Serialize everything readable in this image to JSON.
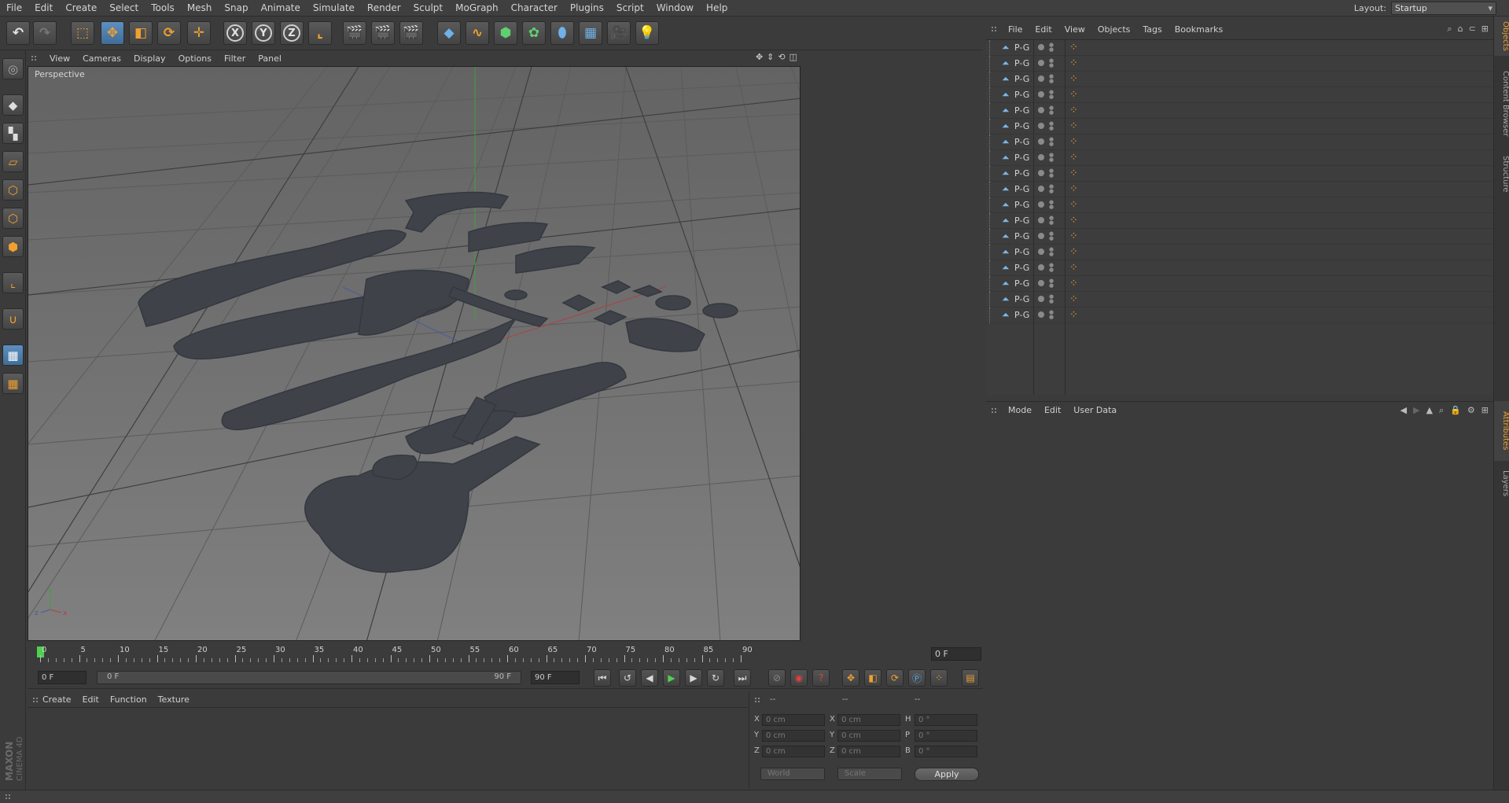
{
  "menubar": {
    "items": [
      "File",
      "Edit",
      "Create",
      "Select",
      "Tools",
      "Mesh",
      "Snap",
      "Animate",
      "Simulate",
      "Render",
      "Sculpt",
      "MoGraph",
      "Character",
      "Plugins",
      "Script",
      "Window",
      "Help"
    ],
    "layout_label": "Layout:",
    "layout_value": "Startup"
  },
  "toolbar": {
    "x_label": "X",
    "y_label": "Y",
    "z_label": "Z"
  },
  "viewport": {
    "menu": [
      "View",
      "Cameras",
      "Display",
      "Options",
      "Filter",
      "Panel"
    ],
    "camera_label": "Perspective"
  },
  "timeline": {
    "ticks": [
      "0",
      "5",
      "10",
      "15",
      "20",
      "25",
      "30",
      "35",
      "40",
      "45",
      "50",
      "55",
      "60",
      "65",
      "70",
      "75",
      "80",
      "85",
      "90"
    ],
    "current_frame": "0 F",
    "start_frame": "0 F",
    "range_start": "0 F",
    "range_end": "90 F",
    "end_frame": "90 F"
  },
  "material_manager": {
    "menu": [
      "Create",
      "Edit",
      "Function",
      "Texture"
    ]
  },
  "coordinates": {
    "header_a": "--",
    "header_b": "--",
    "header_c": "--",
    "rows": [
      {
        "pos_label": "X",
        "pos": "0 cm",
        "size_label": "X",
        "size": "0 cm",
        "rot_label": "H",
        "rot": "0 °"
      },
      {
        "pos_label": "Y",
        "pos": "0 cm",
        "size_label": "Y",
        "size": "0 cm",
        "rot_label": "P",
        "rot": "0 °"
      },
      {
        "pos_label": "Z",
        "pos": "0 cm",
        "size_label": "Z",
        "size": "0 cm",
        "rot_label": "B",
        "rot": "0 °"
      }
    ],
    "space": "World",
    "mode": "Scale",
    "apply_label": "Apply"
  },
  "object_manager": {
    "menu": [
      "File",
      "Edit",
      "View",
      "Objects",
      "Tags",
      "Bookmarks"
    ],
    "objects": [
      "P-G",
      "P-G",
      "P-G",
      "P-G",
      "P-G",
      "P-G",
      "P-G",
      "P-G",
      "P-G",
      "P-G",
      "P-G",
      "P-G",
      "P-G",
      "P-G",
      "P-G",
      "P-G",
      "P-G",
      "P-G"
    ]
  },
  "attributes": {
    "menu": [
      "Mode",
      "Edit",
      "User Data"
    ]
  },
  "side_tabs": [
    "Objects",
    "Content Browser",
    "Structure",
    "Attributes",
    "Layers"
  ],
  "brand": {
    "line1": "MAXON",
    "line2": "CINEMA 4D"
  },
  "colors": {
    "accent": "#f0a030",
    "selection": "#5d8fbf",
    "play": "#4fd04f"
  }
}
